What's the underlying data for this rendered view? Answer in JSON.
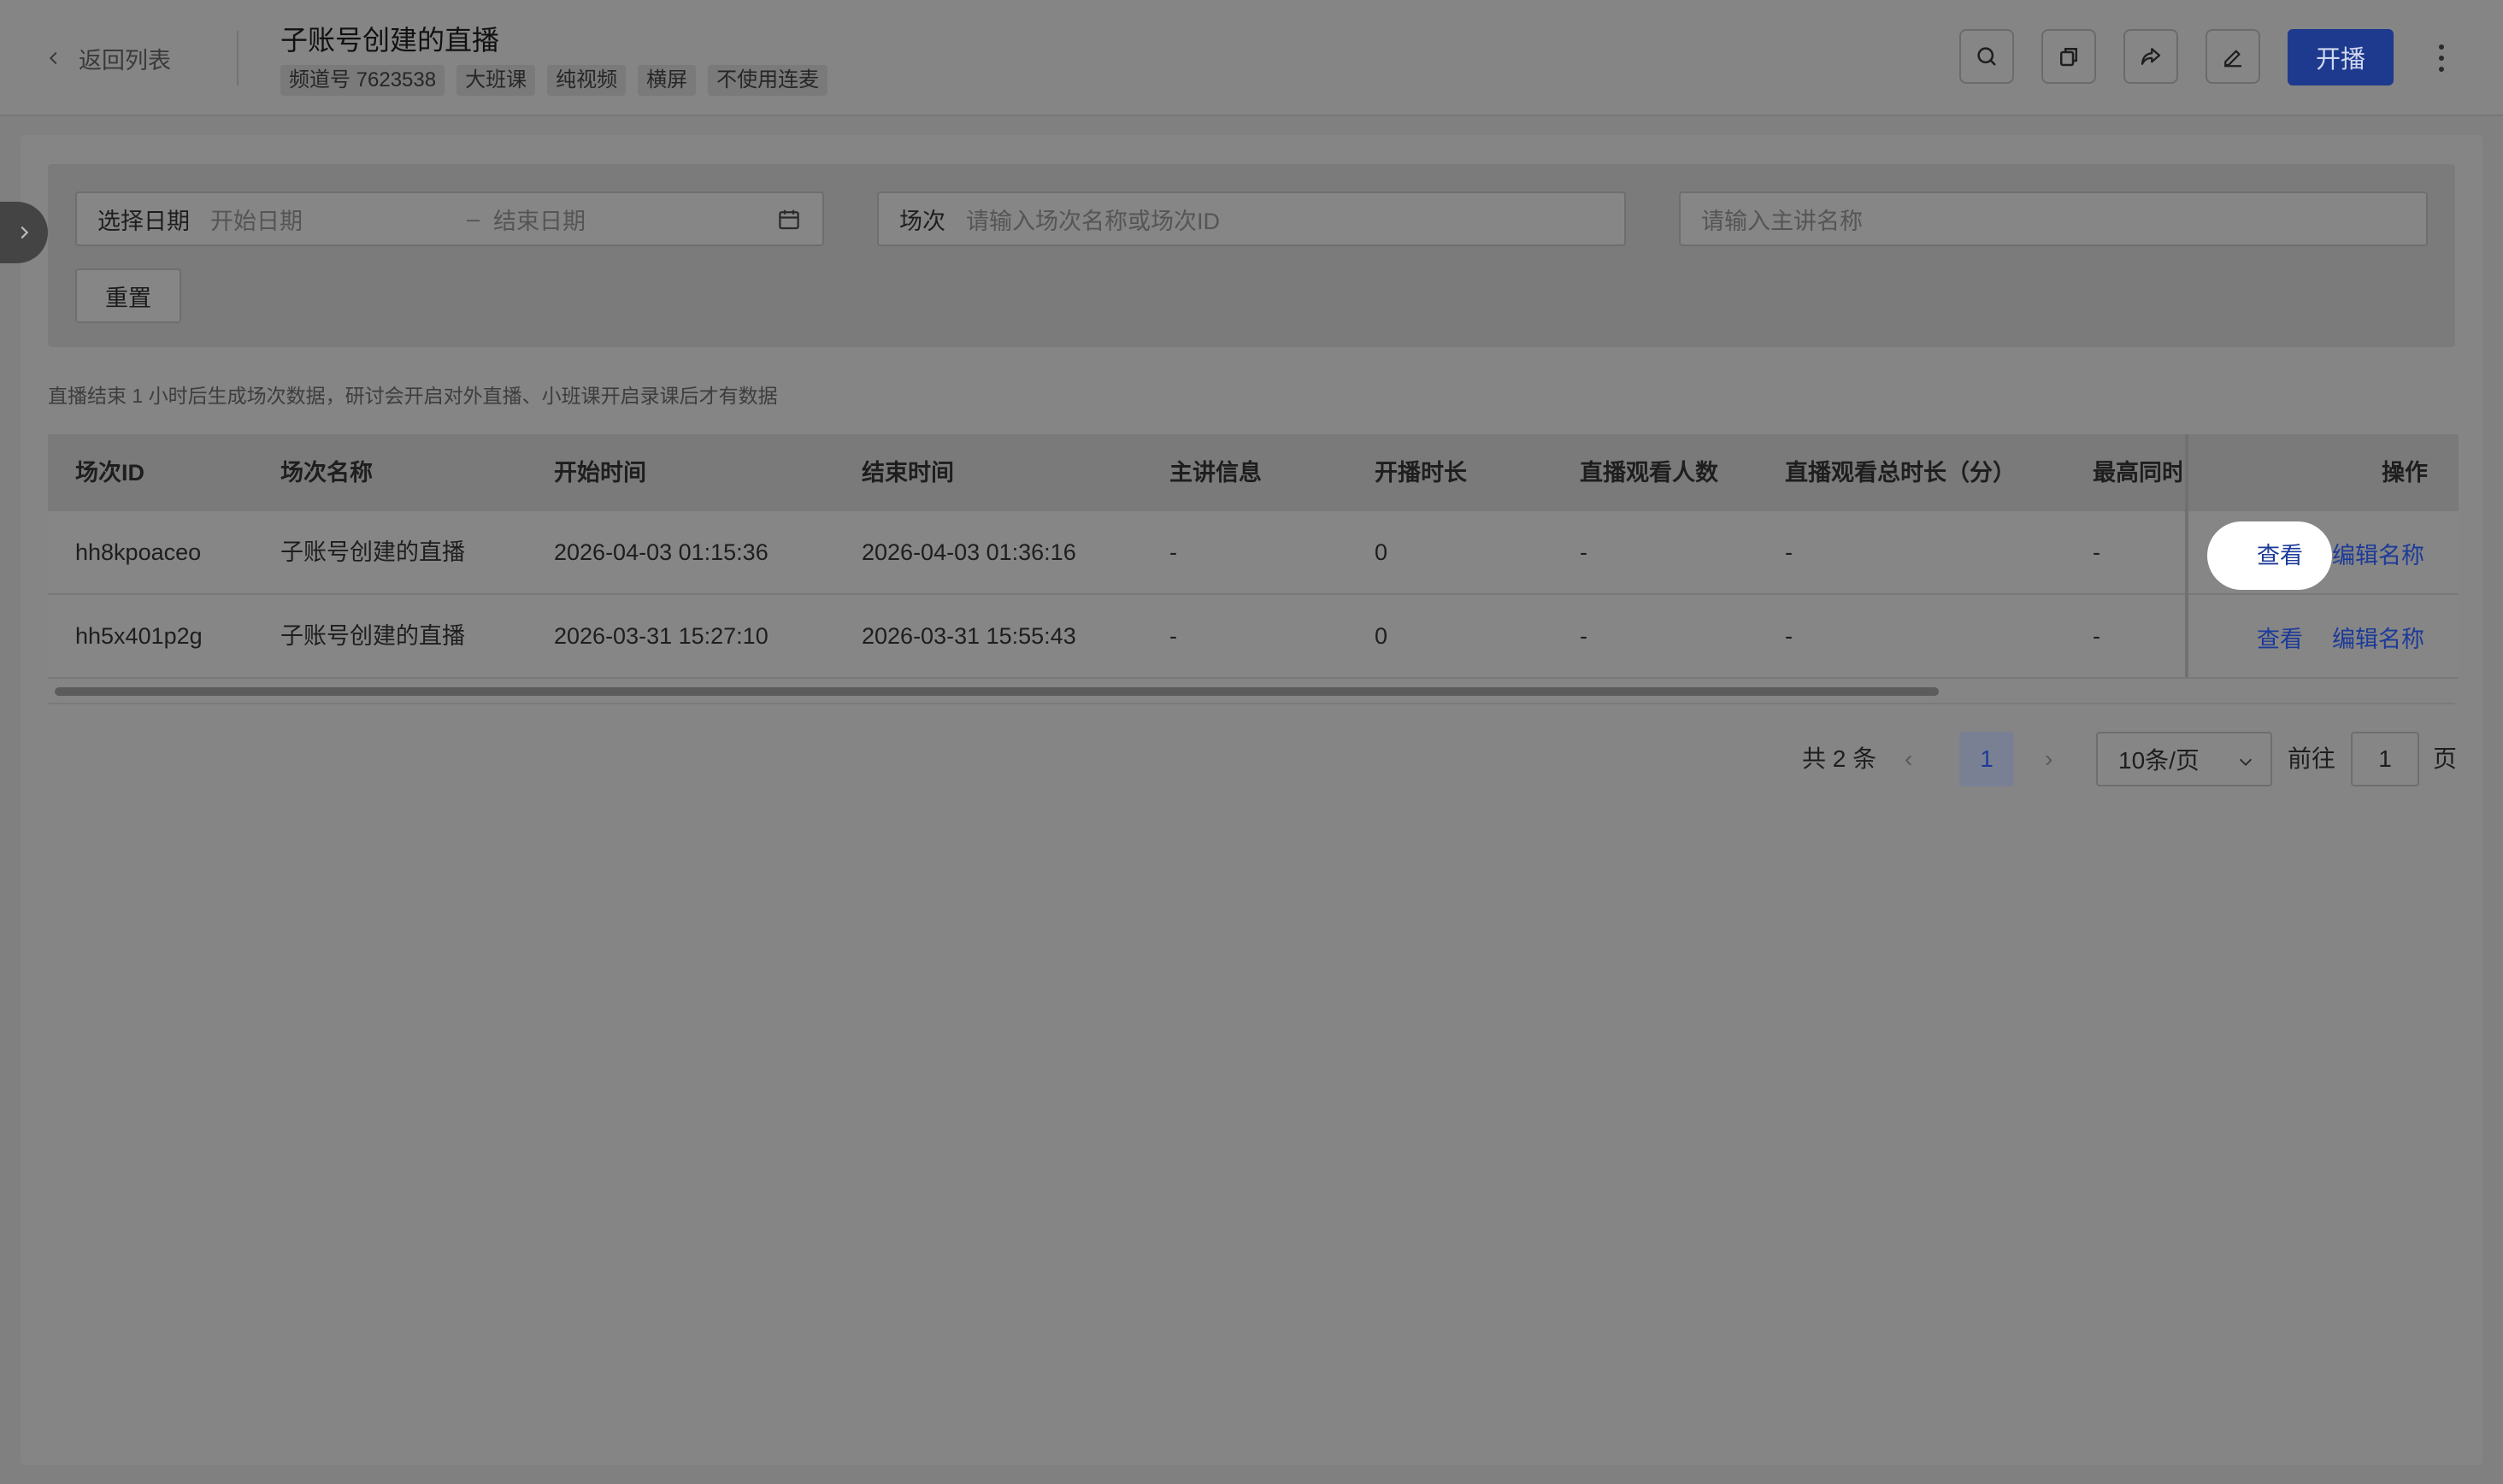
{
  "header": {
    "back_label": "返回列表",
    "title": "子账号创建的直播",
    "tags": [
      "频道号 7623538",
      "大班课",
      "纯视频",
      "横屏",
      "不使用连麦"
    ],
    "start_label": "开播",
    "icons": [
      "search-icon",
      "copy-icon",
      "share-icon",
      "edit-icon",
      "more-icon"
    ]
  },
  "filters": {
    "date_label": "选择日期",
    "start_placeholder": "开始日期",
    "date_separator": "–",
    "end_placeholder": "结束日期",
    "session_label": "场次",
    "session_placeholder": "请输入场次名称或场次ID",
    "host_placeholder": "请输入主讲名称",
    "reset_label": "重置"
  },
  "note": "直播结束 1 小时后生成场次数据，研讨会开启对外直播、小班课开启录课后才有数据",
  "table": {
    "columns": [
      "场次ID",
      "场次名称",
      "开始时间",
      "结束时间",
      "主讲信息",
      "开播时长",
      "直播观看人数",
      "直播观看总时长（分）",
      "最高同时",
      "操作"
    ],
    "rows": [
      {
        "id": "hh8kpoaceo",
        "name": "子账号创建的直播",
        "start": "2026-04-03 01:15:36",
        "end": "2026-04-03 01:36:16",
        "host": "-",
        "duration": "0",
        "viewers": "-",
        "total_minutes": "-",
        "peak": "-",
        "view": "查看",
        "rename": "编辑名称"
      },
      {
        "id": "hh5x401p2g",
        "name": "子账号创建的直播",
        "start": "2026-03-31 15:27:10",
        "end": "2026-03-31 15:55:43",
        "host": "-",
        "duration": "0",
        "viewers": "-",
        "total_minutes": "-",
        "peak": "-",
        "view": "查看",
        "rename": "编辑名称"
      }
    ]
  },
  "pagination": {
    "total": "共 2 条",
    "prev": "‹",
    "current": "1",
    "next": "›",
    "page_size": "10条/页",
    "goto_label": "前往",
    "goto_value": "1",
    "page_suffix": "页"
  },
  "colors": {
    "accent": "#1e3a8f",
    "link": "#1c3a98",
    "overlay_bg": "#808080"
  }
}
